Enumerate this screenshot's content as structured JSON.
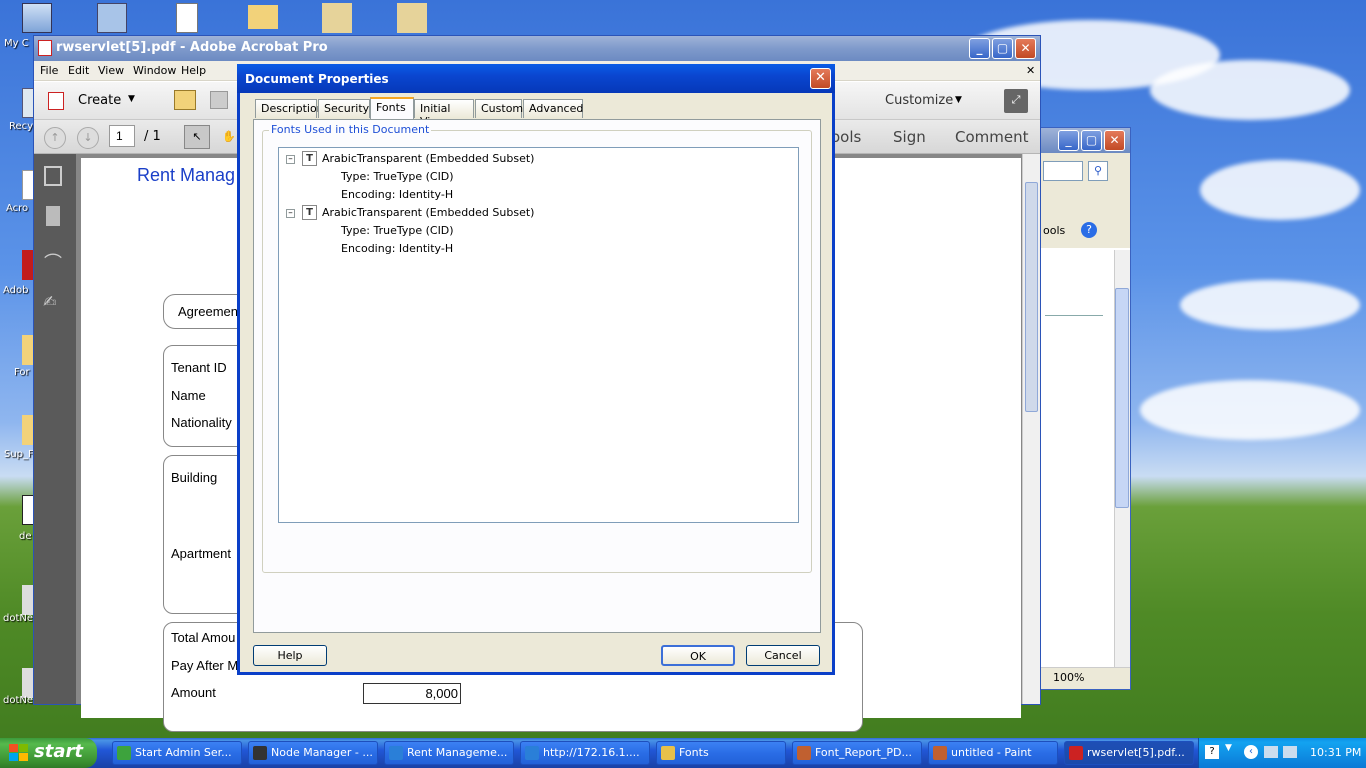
{
  "acrobat": {
    "title": "rwservlet[5].pdf - Adobe Acrobat Pro",
    "menus": [
      "File",
      "Edit",
      "View",
      "Window",
      "Help"
    ],
    "create_label": "Create",
    "customize_label": "Customize",
    "page_current": "1",
    "page_total": "/ 1",
    "right_tools": [
      "ools",
      "Sign",
      "Comment"
    ],
    "doc": {
      "heading": "Rent Manag",
      "agreement_label": "Agreemen",
      "labels": {
        "tenant_id": "Tenant ID",
        "name": "Name",
        "nationality": "Nationality",
        "building": "Building",
        "apartment": "Apartment",
        "total_amount": "Total Amou",
        "pay_after": "Pay After M",
        "amount": "Amount"
      },
      "amount_value": "8,000"
    }
  },
  "ie_window": {
    "zoom": "100%",
    "tools_label": "ools"
  },
  "dialog": {
    "title": "Document Properties",
    "tabs": [
      "Description",
      "Security",
      "Fonts",
      "Initial View",
      "Custom",
      "Advanced"
    ],
    "active_tab": "Fonts",
    "group_title": "Fonts Used in this Document",
    "fonts": [
      {
        "name": "ArabicTransparent (Embedded Subset)",
        "type": "Type: TrueType (CID)",
        "encoding": "Encoding: Identity-H"
      },
      {
        "name": "ArabicTransparent (Embedded Subset)",
        "type": "Type: TrueType (CID)",
        "encoding": "Encoding: Identity-H"
      }
    ],
    "buttons": {
      "help": "Help",
      "ok": "OK",
      "cancel": "Cancel"
    }
  },
  "desktop": {
    "labels": [
      "My C",
      "Recy",
      "Acro",
      "Adob",
      "For",
      "Sup_F",
      "de",
      "dotNe",
      "dotNe"
    ]
  },
  "taskbar": {
    "start_label": "start",
    "items": [
      {
        "label": "Start Admin Ser...",
        "color": "#3da33d"
      },
      {
        "label": "Node Manager - ...",
        "color": "#333333"
      },
      {
        "label": "Rent Manageme...",
        "color": "#2a7fd8"
      },
      {
        "label": "http://172.16.1....",
        "color": "#2a7fd8"
      },
      {
        "label": "Fonts",
        "color": "#e8c04a"
      },
      {
        "label": "Font_Report_PD...",
        "color": "#c06030"
      },
      {
        "label": "untitled - Paint",
        "color": "#c06030"
      },
      {
        "label": "rwservlet[5].pdf...",
        "color": "#cc2222"
      }
    ],
    "clock": "10:31 PM"
  }
}
